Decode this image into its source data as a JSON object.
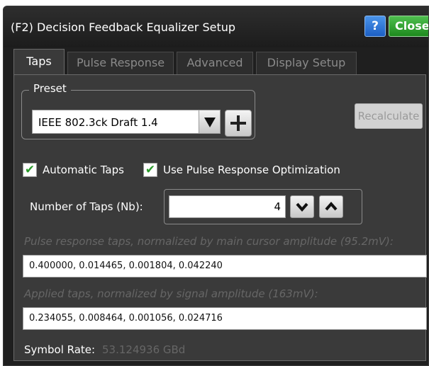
{
  "window": {
    "title": "(F2) Decision Feedback Equalizer Setup",
    "help_label": "?",
    "close_label": "Close"
  },
  "tabs": [
    {
      "label": "Taps",
      "active": true
    },
    {
      "label": "Pulse Response",
      "active": false
    },
    {
      "label": "Advanced",
      "active": false
    },
    {
      "label": "Display Setup",
      "active": false
    }
  ],
  "preset": {
    "legend": "Preset",
    "selected": "IEEE 802.3ck Draft 1.4",
    "dropdown_icon": "triangle-down-icon",
    "add_icon": "plus-icon"
  },
  "recalculate_label": "Recalculate",
  "options": {
    "automatic_taps": {
      "label": "Automatic Taps",
      "checked": true
    },
    "use_pulse_response": {
      "label": "Use Pulse Response Optimization",
      "checked": true
    }
  },
  "taps": {
    "label": "Number of Taps (Nb):",
    "value": "4"
  },
  "pulse_taps": {
    "hint": "Pulse response taps, normalized by main cursor amplitude (95.2mV):",
    "value": "0.400000, 0.014465, 0.001804, 0.042240"
  },
  "applied_taps": {
    "hint": "Applied taps, normalized by signal amplitude (163mV):",
    "value": "0.234055, 0.008464, 0.001056, 0.024716"
  },
  "symbol_rate": {
    "label": "Symbol Rate:",
    "value": "53.124936 GBd"
  },
  "colors": {
    "window_bg": "#1f1f1f",
    "panel_bg": "#3a3a3a",
    "help_blue": "#2f7ad9",
    "close_green": "#2fa32f",
    "check_green": "#2a9a2a",
    "disabled_text": "#666666"
  }
}
